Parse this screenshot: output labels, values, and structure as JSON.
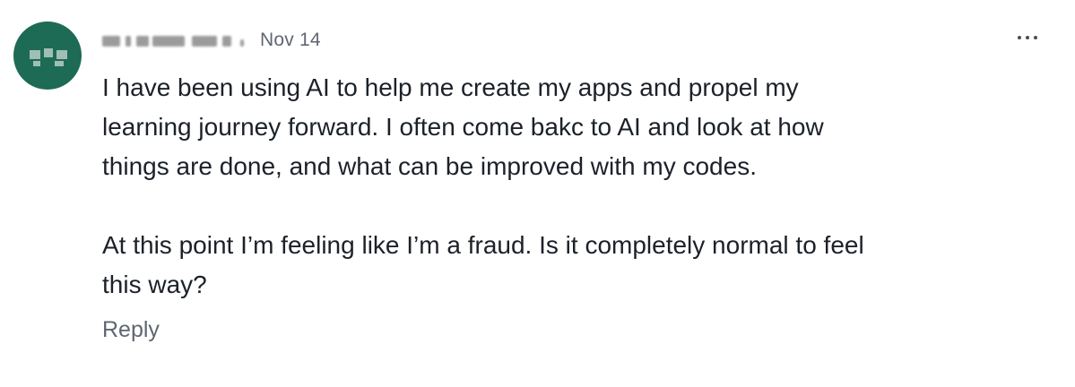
{
  "comment": {
    "author": {
      "name": "",
      "avatar_color": "#1e6b55"
    },
    "date": "Nov 14",
    "more_icon": "more-horizontal-icon",
    "paragraphs": [
      "I have been using AI to help me create my apps and propel my\nlearning journey forward. I often come bakc to AI and look at how\nthings are done, and what can be improved with my codes.",
      "At this point I’m feeling like I’m a fraud. Is it completely normal to feel\nthis way?"
    ],
    "reply_label": "Reply"
  }
}
